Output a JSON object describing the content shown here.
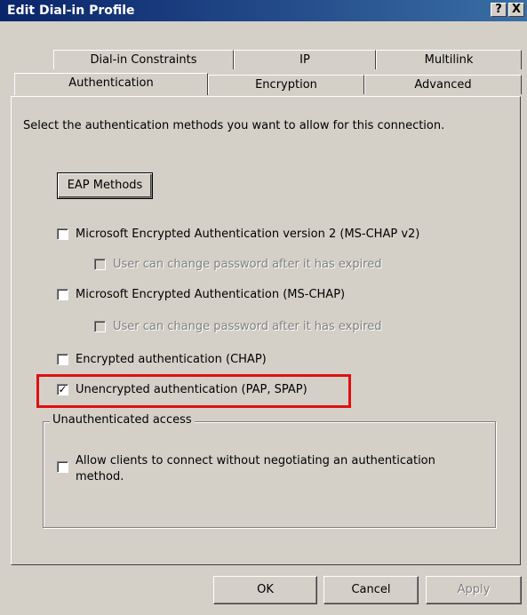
{
  "window": {
    "title": "Edit Dial-in Profile",
    "help_label": "?",
    "close_label": "X"
  },
  "tabs": {
    "row1": [
      "Dial-in Constraints",
      "IP",
      "Multilink"
    ],
    "row2": [
      "Authentication",
      "Encryption",
      "Advanced"
    ],
    "active": "Authentication"
  },
  "content": {
    "instruction": "Select the authentication methods you want to allow for this connection.",
    "eap_button": "EAP Methods",
    "options": [
      {
        "label": "Microsoft Encrypted Authentication version 2 (MS-CHAP v2)",
        "checked": false,
        "enabled": true
      },
      {
        "label": "User can change password after it has expired",
        "checked": false,
        "enabled": false
      },
      {
        "label": "Microsoft Encrypted Authentication (MS-CHAP)",
        "checked": false,
        "enabled": true
      },
      {
        "label": "User can change password after it has expired",
        "checked": false,
        "enabled": false
      },
      {
        "label": "Encrypted authentication (CHAP)",
        "checked": false,
        "enabled": true
      },
      {
        "label": "Unencrypted authentication (PAP, SPAP)",
        "checked": true,
        "enabled": true
      }
    ],
    "group": {
      "label": "Unauthenticated access",
      "option_line1": "Allow clients to connect without negotiating an authentication",
      "option_line2": "method.",
      "checked": false
    }
  },
  "footer": {
    "ok": "OK",
    "cancel": "Cancel",
    "apply": "Apply"
  },
  "colors": {
    "dialog_bg": "#d4d0c8",
    "title_gradient_start": "#0a246a",
    "title_gradient_end": "#3a6ea5",
    "highlight": "#e01010"
  }
}
